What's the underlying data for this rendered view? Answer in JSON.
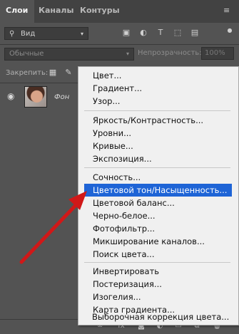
{
  "tabs": [
    {
      "label": "Слои",
      "active": true
    },
    {
      "label": "Каналы",
      "active": false
    },
    {
      "label": "Контуры",
      "active": false
    }
  ],
  "filter": {
    "kind_label": "Вид"
  },
  "blend": {
    "mode": "Обычные",
    "opacity_label": "Непрозрачность:",
    "opacity_value": "100%"
  },
  "lock": {
    "label": "Закрепить:"
  },
  "layer": {
    "name": "Фон"
  },
  "menu": {
    "groups": [
      [
        "Цвет...",
        "Градиент...",
        "Узор..."
      ],
      [
        "Яркость/Контрастность...",
        "Уровни...",
        "Кривые...",
        "Экспозиция..."
      ],
      [
        "Сочность...",
        "Цветовой тон/Насыщенность...",
        "Цветовой баланс...",
        "Черно-белое...",
        "Фотофильтр...",
        "Микширование каналов...",
        "Поиск цвета..."
      ],
      [
        "Инвертировать",
        "Постеризация...",
        "Изогелия...",
        "Карта градиента...",
        "Выборочная коррекция цвета..."
      ]
    ],
    "highlighted": "Цветовой тон/Насыщенность..."
  },
  "colors": {
    "highlight": "#1e64d6",
    "arrow": "#d01818"
  }
}
